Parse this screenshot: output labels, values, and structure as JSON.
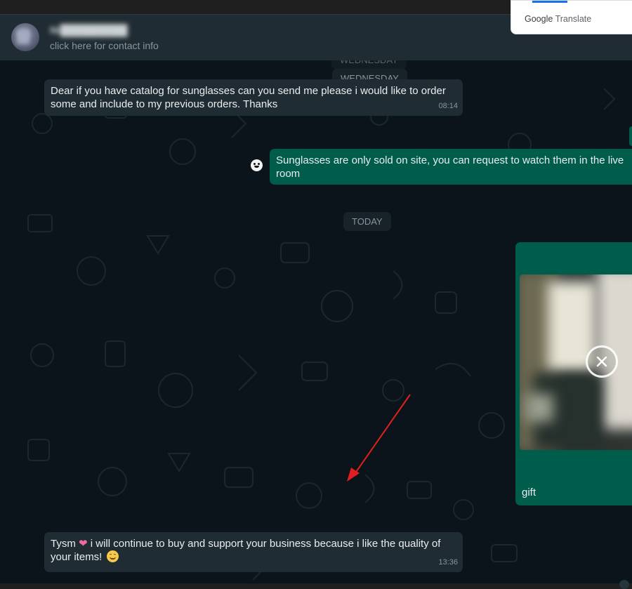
{
  "header": {
    "contact_name": "Ni█████████",
    "contact_sub": "click here for contact info"
  },
  "translate_popup": {
    "brand": "Google",
    "label": "Translate"
  },
  "chat": {
    "date_chip_ghost": "WEDNESDAY",
    "date_chip_1": "WEDNESDAY",
    "date_chip_2": "TODAY",
    "messages": [
      {
        "direction": "incoming",
        "text": "Dear if you have catalog for sunglasses can you send me please i would like to order some and include to my previous orders. Thanks",
        "time": "08:14"
      },
      {
        "direction": "outgoing",
        "text": "Sunglasses are only sold on site, you can request to watch them in the live room"
      },
      {
        "direction": "outgoing",
        "type": "image",
        "caption": "gift",
        "status": "uploading",
        "status_icon": "close-icon"
      },
      {
        "direction": "incoming",
        "text_before": "Tysm",
        "emoji_1": "❤",
        "text_after": "i will continue to buy and support your business because i like the quality of your items!",
        "emoji_2": "smile-emoji",
        "time": "13:36"
      }
    ]
  },
  "colors": {
    "background": "#0b141a",
    "header": "#202c33",
    "incoming_bubble": "#202c33",
    "outgoing_bubble": "#005c4b",
    "muted_text": "#8696a0",
    "annotation_arrow": "#e02020"
  }
}
